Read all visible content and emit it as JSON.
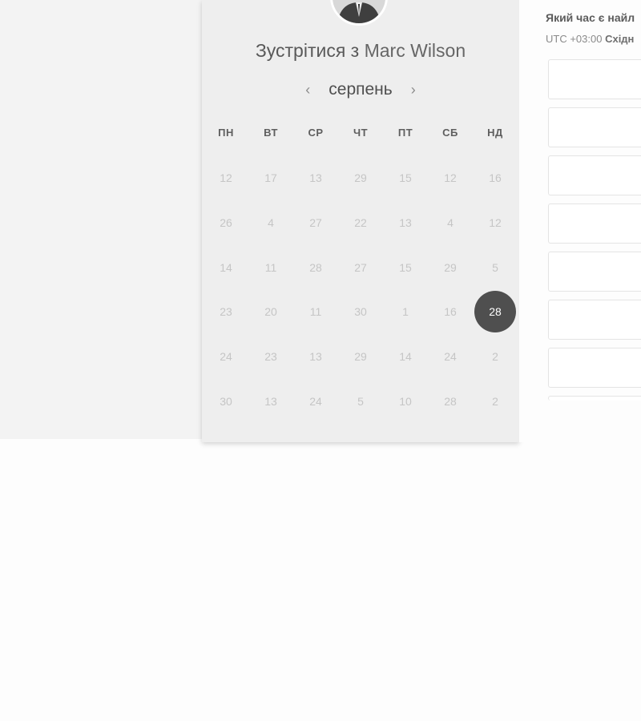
{
  "scheduler": {
    "title_prefix": "Зустрітися з",
    "host_name": "Marc Wilson",
    "month_label": "серпень",
    "weekdays": [
      "ПН",
      "ВТ",
      "СР",
      "ЧТ",
      "ПТ",
      "СБ",
      "НД"
    ],
    "weeks": [
      [
        "12",
        "17",
        "13",
        "29",
        "15",
        "12",
        "16"
      ],
      [
        "26",
        "4",
        "27",
        "22",
        "13",
        "4",
        "12"
      ],
      [
        "14",
        "11",
        "28",
        "27",
        "15",
        "29",
        "5"
      ],
      [
        "23",
        "20",
        "11",
        "30",
        "1",
        "16",
        "28"
      ],
      [
        "24",
        "23",
        "13",
        "29",
        "14",
        "24",
        "2"
      ],
      [
        "30",
        "13",
        "24",
        "5",
        "10",
        "28",
        "2"
      ]
    ],
    "selected_day": "28"
  },
  "times": {
    "question": "Який час є найл",
    "tz_offset": "UTC +03:00",
    "tz_name": "Східн",
    "slot_count": 7
  },
  "colors": {
    "selected_day_bg": "#4f4f4f",
    "card_bg": "#eeeeee",
    "muted_day": "#c5c5c5"
  }
}
